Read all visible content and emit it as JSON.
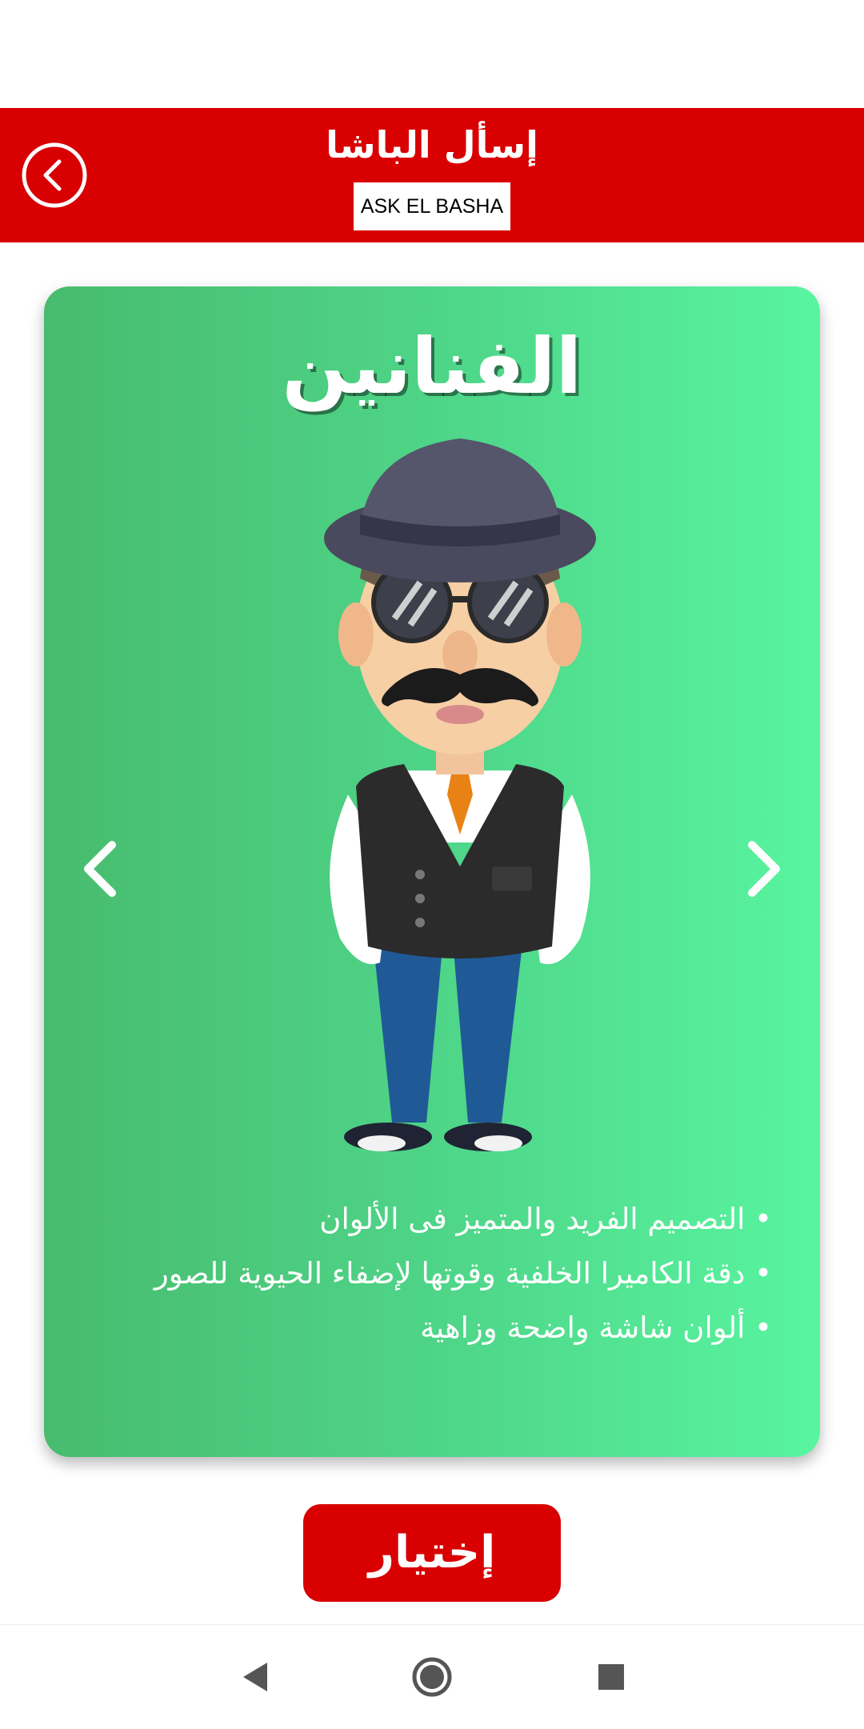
{
  "header": {
    "title": "إسأل الباشا",
    "subtitle": "ASK EL BASHA",
    "back_icon": "chevron-left-circle-icon",
    "color": "#d80000"
  },
  "card": {
    "title": "الفنانين",
    "features": [
      "التصميم الفريد والمتميز فى الألوان",
      "دقة الكاميرا الخلفية وقوتها لإضفاء الحيوية للصور",
      "ألوان شاشة واضحة وزاهية"
    ],
    "prev_icon": "chevron-left-icon",
    "next_icon": "chevron-right-icon",
    "gradient": [
      "#48bb6e",
      "#58f5a0"
    ]
  },
  "actions": {
    "choose_label": "إختيار"
  },
  "system_nav": {
    "back_icon": "triangle-back-icon",
    "home_icon": "circle-home-icon",
    "recents_icon": "square-recents-icon"
  }
}
